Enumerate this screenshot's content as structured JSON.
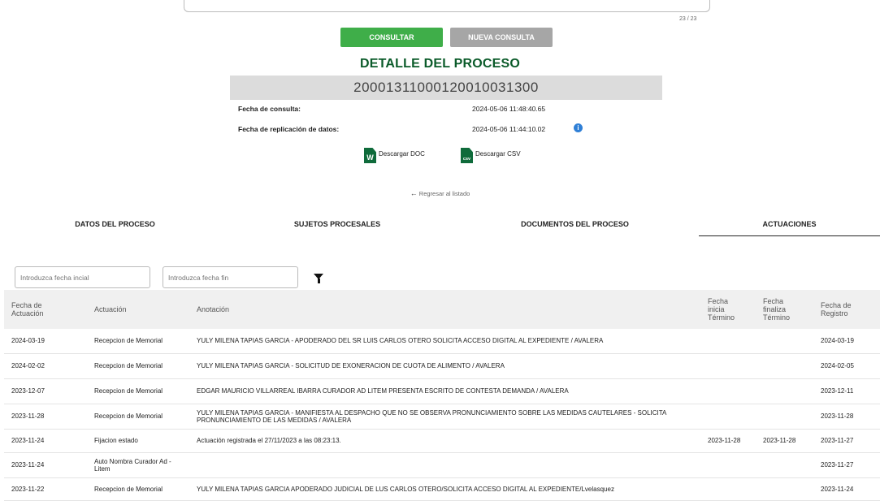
{
  "search": {
    "counter": "23 / 23"
  },
  "buttons": {
    "consultar": "CONSULTAR",
    "nueva": "NUEVA CONSULTA"
  },
  "detail": {
    "title": "DETALLE DEL PROCESO",
    "radicado": "20001311000120010031300",
    "fecha_consulta_label": "Fecha de consulta:",
    "fecha_consulta_value": "2024-05-06 11:48:40.65",
    "fecha_replicacion_label": "Fecha de replicación de datos:",
    "fecha_replicacion_value": "2024-05-06 11:44:10.02",
    "info_icon": "i"
  },
  "downloads": {
    "doc_label": "Descargar DOC",
    "doc_icon": "W",
    "csv_label": "Descargar CSV",
    "csv_icon": "csv"
  },
  "back": {
    "arrow": "←",
    "label": "Regresar al listado"
  },
  "tabs": [
    {
      "label": "DATOS DEL PROCESO"
    },
    {
      "label": "SUJETOS PROCESALES"
    },
    {
      "label": "DOCUMENTOS DEL PROCESO"
    },
    {
      "label": "ACTUACIONES"
    }
  ],
  "filters": {
    "start_placeholder": "Introduzca fecha incial",
    "end_placeholder": "Introduzca fecha fin"
  },
  "table": {
    "headers": {
      "fecha_actuacion_1": "Fecha de",
      "fecha_actuacion_2": "Actuación",
      "actuacion": "Actuación",
      "anotacion": "Anotación",
      "inicia_1": "Fecha",
      "inicia_2": "inicia",
      "inicia_3": "Término",
      "finaliza_1": "Fecha",
      "finaliza_2": "finaliza",
      "finaliza_3": "Término",
      "registro_1": "Fecha de",
      "registro_2": "Registro"
    },
    "rows": [
      {
        "fecha": "2024-03-19",
        "actuacion": "Recepcion de Memorial",
        "anotacion": "YULY MILENA TAPIAS GARCIA - APODERADO DEL SR LUIS CARLOS OTERO SOLICITA ACCESO DIGITAL AL EXPEDIENTE / AVALERA",
        "inicia": "",
        "finaliza": "",
        "registro": "2024-03-19"
      },
      {
        "fecha": "2024-02-02",
        "actuacion": "Recepcion de Memorial",
        "anotacion": "YULY MILENA TAPIAS GARCIA - SOLICITUD DE EXONERACION DE CUOTA DE ALIMENTO / AVALERA",
        "inicia": "",
        "finaliza": "",
        "registro": "2024-02-05"
      },
      {
        "fecha": "2023-12-07",
        "actuacion": "Recepcion de Memorial",
        "anotacion": "EDGAR MAURICIO VILLARREAL IBARRA CURADOR AD LITEM PRESENTA ESCRITO DE CONTESTA DEMANDA / AVALERA",
        "inicia": "",
        "finaliza": "",
        "registro": "2023-12-11"
      },
      {
        "fecha": "2023-11-28",
        "actuacion": "Recepcion de Memorial",
        "anotacion": "YULY MILENA TAPIAS GARCIA - MANIFIESTA AL DESPACHO QUE NO SE OBSERVA PRONUNCIAMIENTO SOBRE LAS MEDIDAS CAUTELARES - SOLICITA PRONUNCIAMIENTO DE LAS MEDIDAS / AVALERA",
        "inicia": "",
        "finaliza": "",
        "registro": "2023-11-28"
      },
      {
        "fecha": "2023-11-24",
        "actuacion": "Fijacion estado",
        "anotacion": "Actuación registrada el 27/11/2023 a las 08:23:13.",
        "inicia": "2023-11-28",
        "finaliza": "2023-11-28",
        "registro": "2023-11-27"
      },
      {
        "fecha": "2023-11-24",
        "actuacion": "Auto Nombra Curador Ad - Litem",
        "anotacion": "",
        "inicia": "",
        "finaliza": "",
        "registro": "2023-11-27"
      },
      {
        "fecha": "2023-11-22",
        "actuacion": "Recepcion de Memorial",
        "anotacion": "YULY MILENA TAPIAS GARCIA APODERADO JUDICIAL DE LUS CARLOS OTERO/SOLICITA ACCESO DIGITAL AL EXPEDIENTE/Lvelasquez",
        "inicia": "",
        "finaliza": "",
        "registro": "2023-11-24"
      }
    ]
  }
}
